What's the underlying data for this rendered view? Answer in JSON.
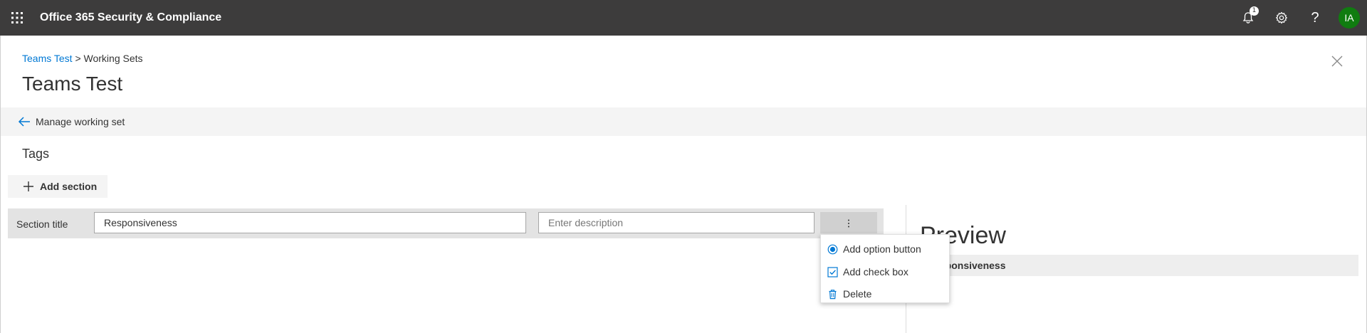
{
  "app": {
    "title": "Office 365 Security & Compliance",
    "notification_count": "1",
    "help_glyph": "?",
    "user_initials": "IA",
    "avatar_color": "#107c10",
    "topbar_color": "#3d3c3c"
  },
  "breadcrumb": {
    "parent": "Teams Test",
    "separator": ">",
    "current": "Working Sets"
  },
  "page": {
    "title": "Teams Test"
  },
  "command_bar": {
    "back_label": "Manage working set"
  },
  "tags": {
    "heading": "Tags",
    "add_section_label": "Add section",
    "section": {
      "label": "Section title",
      "title_value": "Responsiveness",
      "description_value": "",
      "description_placeholder": "Enter description"
    }
  },
  "menu": {
    "items": [
      {
        "label": "Add option button",
        "icon": "radio-button-icon"
      },
      {
        "label": "Add check box",
        "icon": "checkbox-icon"
      },
      {
        "label": "Delete",
        "icon": "trash-icon"
      }
    ]
  },
  "preview": {
    "title": "Preview",
    "section_title": "Responsiveness"
  },
  "icons": {
    "app_launcher": "waffle-icon",
    "notifications": "bell-icon",
    "settings": "gear-icon",
    "help": "help-icon",
    "close": "close-icon",
    "back": "back-arrow-icon",
    "add": "plus-icon",
    "more": "more-vertical-icon"
  },
  "colors": {
    "accent": "#0078d4"
  }
}
